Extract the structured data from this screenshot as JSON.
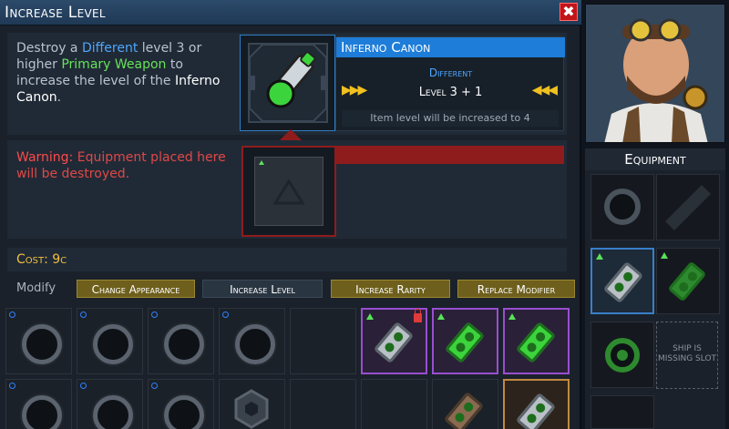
{
  "dialog": {
    "title": "Increase Level",
    "close_label": "✖"
  },
  "description": {
    "part1": "Destroy a ",
    "different": "Different",
    "part2": " level 3 or higher ",
    "primary": "Primary Weapon",
    "part3": " to increase the level of the ",
    "name": "Inferno Canon",
    "part4": "."
  },
  "item_card": {
    "name": "Inferno Canon",
    "rarity": "Different",
    "level_text": "Level 3 + 1",
    "arrows_left": "▶▶▶",
    "arrows_right": "◀◀◀",
    "note": "Item level will be increased to 4"
  },
  "warning": {
    "label": "Warning:",
    "text": " Equipment placed here will be destroyed."
  },
  "cost": {
    "text": "Cost: 9c"
  },
  "tabs": {
    "modify_label": "Modify",
    "items": [
      "Change Appearance",
      "Increase Level",
      "Increase Rarity",
      "Replace Modifier"
    ]
  },
  "equipment": {
    "title": "Equipment",
    "missing_slot": "SHIP IS MISSING SLOT"
  },
  "colors": {
    "accent_blue": "#1e7dd8",
    "warning_red": "#8f1c1c",
    "cost_gold": "#f0c040",
    "weapon_green": "#3cd43c",
    "rarity_purple": "#9a4ed0"
  }
}
